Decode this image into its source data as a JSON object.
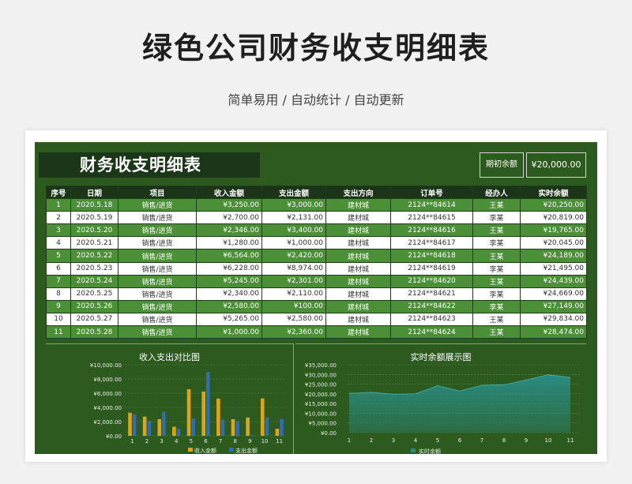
{
  "page": {
    "title": "绿色公司财务收支明细表",
    "subtitle": "简单易用 / 自动统计 / 自动更新"
  },
  "sheet": {
    "title": "财务收支明细表",
    "opening_balance_label": "期初余额",
    "opening_balance_value": "¥20,000.00"
  },
  "table": {
    "headers": [
      "序号",
      "日期",
      "项目",
      "收入金额",
      "支出金额",
      "支出方向",
      "订单号",
      "经办人",
      "实时余额"
    ],
    "rows": [
      [
        "1",
        "2020.5.18",
        "销售/进货",
        "¥3,250.00",
        "¥3,000.00",
        "建材城",
        "2124**84614",
        "王某",
        "¥20,250.00"
      ],
      [
        "2",
        "2020.5.19",
        "销售/进货",
        "¥2,700.00",
        "¥2,131.00",
        "建材城",
        "2124**84615",
        "李某",
        "¥20,819.00"
      ],
      [
        "3",
        "2020.5.20",
        "销售/进货",
        "¥2,346.00",
        "¥3,400.00",
        "建材城",
        "2124**84616",
        "王某",
        "¥19,765.00"
      ],
      [
        "4",
        "2020.5.21",
        "销售/进货",
        "¥1,280.00",
        "¥1,000.00",
        "建材城",
        "2124**84617",
        "李某",
        "¥20,045.00"
      ],
      [
        "5",
        "2020.5.22",
        "销售/进货",
        "¥6,564.00",
        "¥2,420.00",
        "建材城",
        "2124**84618",
        "王某",
        "¥24,189.00"
      ],
      [
        "6",
        "2020.5.23",
        "销售/进货",
        "¥6,228.00",
        "¥8,974.00",
        "建材城",
        "2124**84619",
        "李某",
        "¥21,495.00"
      ],
      [
        "7",
        "2020.5.24",
        "销售/进货",
        "¥5,245.00",
        "¥2,301.00",
        "建材城",
        "2124**84620",
        "王某",
        "¥24,439.00"
      ],
      [
        "8",
        "2020.5.25",
        "销售/进货",
        "¥2,340.00",
        "¥2,110.00",
        "建材城",
        "2124**84621",
        "李某",
        "¥24,669.00"
      ],
      [
        "9",
        "2020.5.26",
        "销售/进货",
        "¥2,580.00",
        "¥100.00",
        "建材城",
        "2124**84622",
        "李某",
        "¥27,149.00"
      ],
      [
        "10",
        "2020.5.27",
        "销售/进货",
        "¥5,265.00",
        "¥2,580.00",
        "建材城",
        "2124**84623",
        "王某",
        "¥29,834.00"
      ],
      [
        "11",
        "2020.5.28",
        "销售/进货",
        "¥1,000.00",
        "¥2,360.00",
        "建材城",
        "2124**84624",
        "王某",
        "¥28,474.00"
      ]
    ]
  },
  "chart_data": [
    {
      "type": "bar",
      "title": "收入支出对比图",
      "categories": [
        "1",
        "2",
        "3",
        "4",
        "5",
        "6",
        "7",
        "8",
        "9",
        "10",
        "11"
      ],
      "series": [
        {
          "name": "收入金额",
          "color": "#e0a418",
          "values": [
            3250,
            2700,
            2346,
            1280,
            6564,
            6228,
            5245,
            2340,
            2580,
            5265,
            1000
          ]
        },
        {
          "name": "支出金额",
          "color": "#2f6db5",
          "values": [
            3000,
            2131,
            3400,
            1000,
            2420,
            8974,
            2301,
            2110,
            100,
            2580,
            2360
          ]
        }
      ],
      "ylim": [
        0,
        10000
      ],
      "yticks": [
        "¥0.00",
        "¥2,000.00",
        "¥4,000.00",
        "¥6,000.00",
        "¥8,000.00",
        "¥10,000.00"
      ],
      "legend": "bottom",
      "grid": true
    },
    {
      "type": "area",
      "title": "实时余额展示图",
      "categories": [
        "1",
        "2",
        "3",
        "4",
        "5",
        "6",
        "7",
        "8",
        "9",
        "10",
        "11"
      ],
      "series": [
        {
          "name": "实时余额",
          "color": "#2b8d86",
          "values": [
            20250,
            20819,
            19765,
            20045,
            24189,
            21495,
            24439,
            24669,
            27149,
            29834,
            28474
          ]
        }
      ],
      "ylim": [
        0,
        35000
      ],
      "yticks": [
        "¥0.00",
        "¥5,000.00",
        "¥10,000.00",
        "¥15,000.00",
        "¥20,000.00",
        "¥25,000.00",
        "¥30,000.00",
        "¥35,000.00"
      ],
      "legend": "bottom",
      "grid": true
    }
  ]
}
